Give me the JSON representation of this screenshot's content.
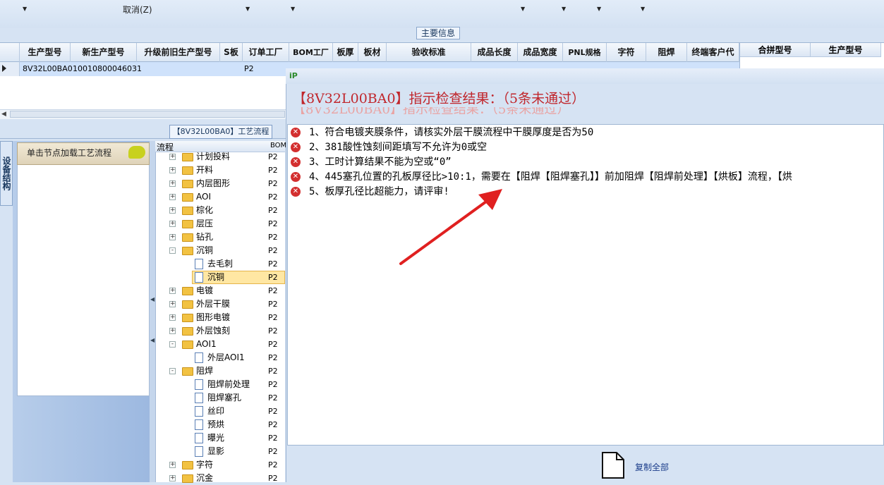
{
  "toolbar": {
    "cancel_label": "取消(Z)"
  },
  "main_info_tab": "主要信息",
  "grid": {
    "headers": [
      "生产型号",
      "新生产型号",
      "升级前旧生产型号",
      "S板",
      "订单工厂",
      "BOM工厂",
      "板厚",
      "板材",
      "验收标准",
      "成品长度",
      "成品宽度",
      "PNL规格",
      "字符",
      "阻焊",
      "终端客户代"
    ],
    "row": {
      "c0": "8V32L00BA0",
      "c1": "10010800046031",
      "c4": "P2"
    }
  },
  "side_grid": {
    "headers": [
      "合拼型号",
      "生产型号"
    ]
  },
  "process_tab": "【8V32L00BA0】工艺流程",
  "vertical_tab": "设备结构",
  "struct_panel": {
    "label": "单击节点加载工艺流程"
  },
  "tree": {
    "header_flow": "流程",
    "header_bom": "BOM",
    "nodes": [
      {
        "label": "计划投料",
        "bom": "P2"
      },
      {
        "label": "开料",
        "bom": "P2"
      },
      {
        "label": "内层图形",
        "bom": "P2"
      },
      {
        "label": "AOI",
        "bom": "P2"
      },
      {
        "label": "棕化",
        "bom": "P2"
      },
      {
        "label": "层压",
        "bom": "P2"
      },
      {
        "label": "钻孔",
        "bom": "P2"
      },
      {
        "label": "沉铜",
        "bom": "P2"
      },
      {
        "label": "去毛刺",
        "bom": "P2"
      },
      {
        "label": "沉铜",
        "bom": "P2"
      },
      {
        "label": "电镀",
        "bom": "P2"
      },
      {
        "label": "外层干膜",
        "bom": "P2"
      },
      {
        "label": "图形电镀",
        "bom": "P2"
      },
      {
        "label": "外层蚀刻",
        "bom": "P2"
      },
      {
        "label": "AOI1",
        "bom": "P2"
      },
      {
        "label": "外层AOI1",
        "bom": "P2"
      },
      {
        "label": "阻焊",
        "bom": "P2"
      },
      {
        "label": "阻焊前处理",
        "bom": "P2"
      },
      {
        "label": "阻焊塞孔",
        "bom": "P2"
      },
      {
        "label": "丝印",
        "bom": "P2"
      },
      {
        "label": "预烘",
        "bom": "P2"
      },
      {
        "label": "曝光",
        "bom": "P2"
      },
      {
        "label": "显影",
        "bom": "P2"
      },
      {
        "label": "字符",
        "bom": "P2"
      },
      {
        "label": "沉金",
        "bom": "P2"
      }
    ]
  },
  "dialog": {
    "title": "【8V32L00BA0】指示检查结果：（5条未通过）",
    "messages": [
      "1、符合电镀夹膜条件，请核实外层干膜流程中干膜厚度是否为50",
      "2、381酸性蚀刻间距填写不允许为0或空",
      "3、工时计算结果不能为空或“0”",
      "4、445塞孔位置的孔板厚径比>10:1，需要在【阻焊【阻焊塞孔】】前加阻焊【阻焊前处理】【烘板】流程，【烘",
      "5、板厚孔径比超能力，请评审!"
    ],
    "copy_all": "复制全部"
  },
  "colors": {
    "error": "#d32f2f",
    "title": "#c0262c",
    "arrow": "#e02020",
    "selection": "#ffe7a3"
  }
}
